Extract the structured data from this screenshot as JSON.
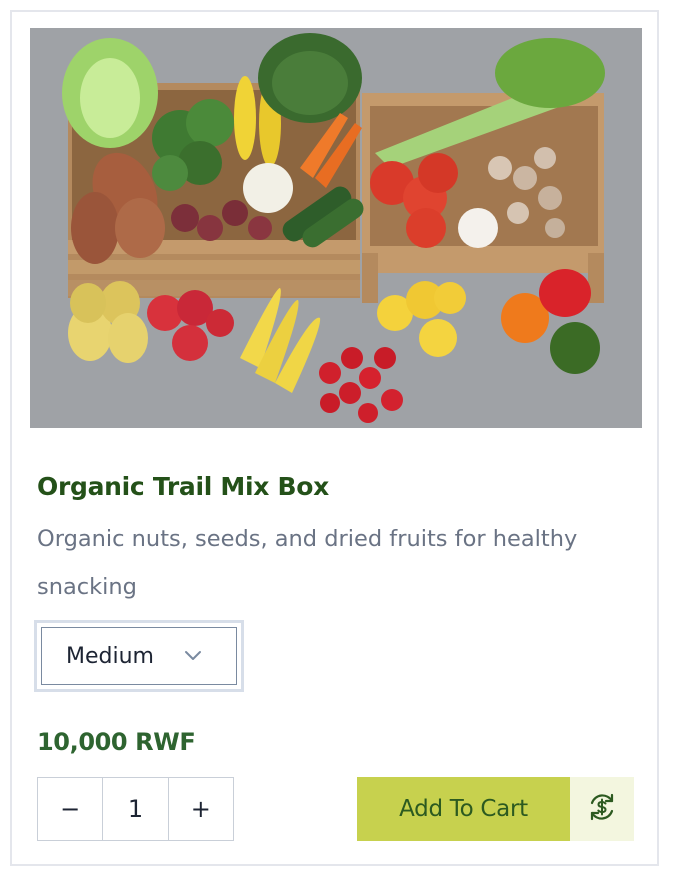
{
  "product": {
    "image_alt": "Fresh vegetables and fruits in wooden crates",
    "title": "Organic Trail Mix Box",
    "description": "Organic nuts, seeds, and dried fruits for healthy snacking",
    "size": {
      "selected": "Medium",
      "icon": "chevron-down-icon"
    },
    "price": "10,000 RWF",
    "quantity": {
      "decrement": "−",
      "value": "1",
      "increment": "+"
    },
    "add_to_cart_label": "Add To Cart",
    "subscribe_icon": "recurring-dollar-icon"
  },
  "colors": {
    "title": "#245119",
    "price": "#2e6430",
    "button_bg": "#c7d14e",
    "button_text": "#2c5a20",
    "subscribe_bg": "#f3f6df"
  }
}
